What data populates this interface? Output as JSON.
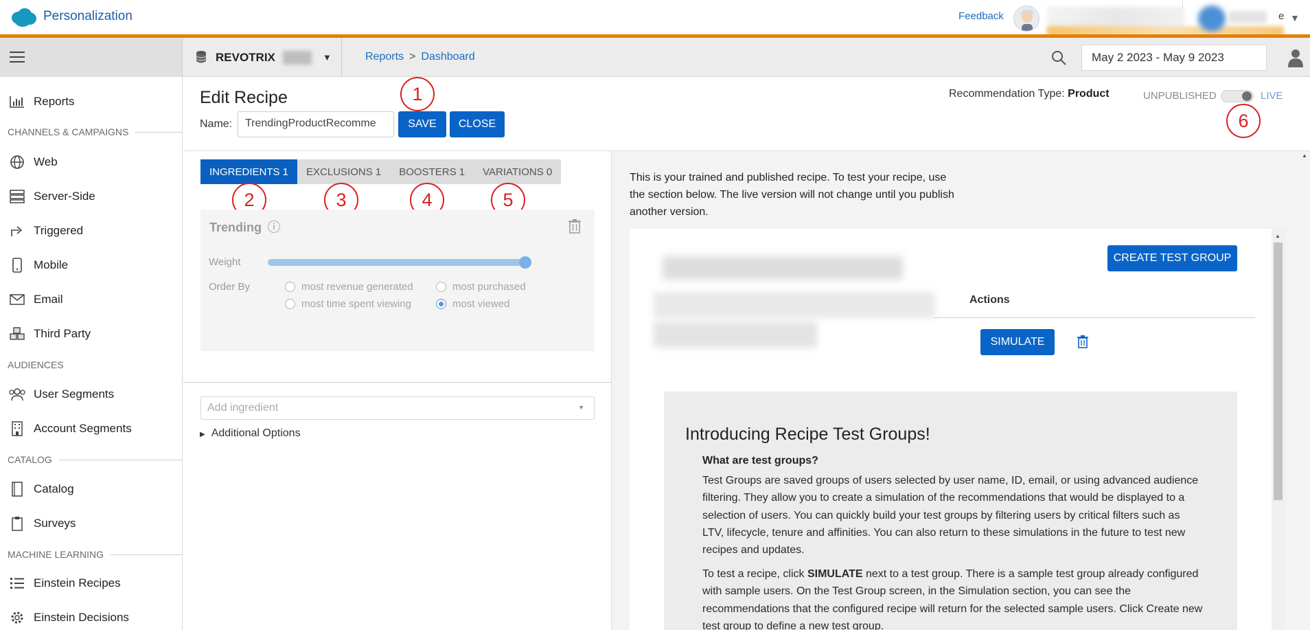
{
  "app": {
    "title": "Personalization",
    "feedback": "Feedback",
    "user_suffix": "e"
  },
  "subbar": {
    "account": "REVOTRIX",
    "breadcrumb": [
      "Reports",
      "Dashboard"
    ],
    "breadcrumb_sep": ">",
    "date_range": "May 2 2023 - May 9 2023"
  },
  "nav": {
    "items": [
      {
        "label": "Reports",
        "icon": "bar-chart-icon"
      },
      {
        "label": "Web",
        "icon": "globe-icon"
      },
      {
        "label": "Server-Side",
        "icon": "server-icon"
      },
      {
        "label": "Triggered",
        "icon": "share-icon"
      },
      {
        "label": "Mobile",
        "icon": "phone-icon"
      },
      {
        "label": "Email",
        "icon": "envelope-icon"
      },
      {
        "label": "Third Party",
        "icon": "cubes-icon"
      },
      {
        "label": "User Segments",
        "icon": "users-icon"
      },
      {
        "label": "Account Segments",
        "icon": "building-icon"
      },
      {
        "label": "Catalog",
        "icon": "book-icon"
      },
      {
        "label": "Surveys",
        "icon": "clipboard-icon"
      },
      {
        "label": "Einstein Recipes",
        "icon": "list-icon"
      },
      {
        "label": "Einstein Decisions",
        "icon": "gear-icon"
      }
    ],
    "sections": [
      "CHANNELS & CAMPAIGNS",
      "AUDIENCES",
      "CATALOG",
      "MACHINE LEARNING"
    ]
  },
  "editor": {
    "title": "Edit Recipe",
    "name_label": "Name:",
    "name_value": "TrendingProductRecomme",
    "save": "SAVE",
    "close": "CLOSE",
    "rec_type_label": "Recommendation Type:",
    "rec_type_value": "Product",
    "unpublished": "UNPUBLISHED",
    "live": "LIVE",
    "published_live": true
  },
  "tabs": [
    {
      "label": "INGREDIENTS 1",
      "active": true
    },
    {
      "label": "EXCLUSIONS 1",
      "active": false
    },
    {
      "label": "BOOSTERS 1",
      "active": false
    },
    {
      "label": "VARIATIONS 0",
      "active": false
    }
  ],
  "annotations": [
    "1",
    "2",
    "3",
    "4",
    "5",
    "6"
  ],
  "ingredient": {
    "title": "Trending",
    "weight_label": "Weight",
    "weight_value": 1.0,
    "order_label": "Order By",
    "options": [
      {
        "label": "most revenue generated",
        "selected": false
      },
      {
        "label": "most purchased",
        "selected": false
      },
      {
        "label": "most time spent viewing",
        "selected": false
      },
      {
        "label": "most viewed",
        "selected": true
      }
    ]
  },
  "add_ingredient": {
    "placeholder": "Add ingredient"
  },
  "additional_options": "Additional Options",
  "right": {
    "intro": "This is your trained and published recipe. To test your recipe, use the section below. The live version will not change until you publish another version.",
    "create_test_group": "CREATE TEST GROUP",
    "actions": "Actions",
    "simulate": "SIMULATE",
    "intro_box": {
      "title": "Introducing Recipe Test Groups!",
      "heading": "What are test groups?",
      "p1": "Test Groups are saved groups of users selected by user name, ID, email, or using advanced audience filtering. They allow you to create a simulation of the recommendations that would be displayed to a selection of users. You can quickly build your test groups by filtering users by critical filters such as LTV, lifecycle, tenure and affinities. You can also return to these simulations in the future to test new recipes and updates.",
      "p2_a": "To test a recipe, click ",
      "p2_b": "SIMULATE",
      "p2_c": " next to a test group. There is a sample test group already configured with sample users. On the Test Group screen, in the Simulation section, you can see the recommendations that the configured recipe will return for the selected sample users. Click Create new test group to define a new test group."
    }
  },
  "colors": {
    "brand_blue": "#0a64c8",
    "accent_orange": "#e67e00",
    "annotation_red": "#d92020"
  }
}
